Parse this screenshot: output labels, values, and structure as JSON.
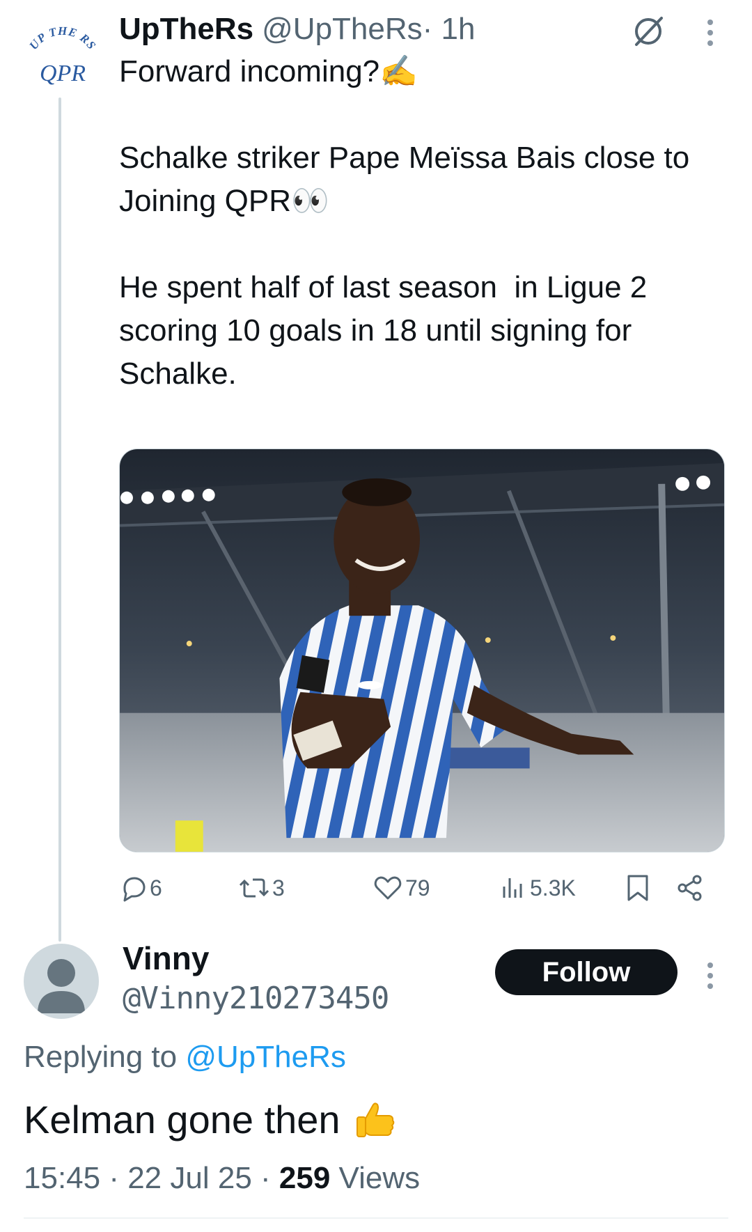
{
  "tweet": {
    "author_name": "UpTheRs",
    "author_handle": "@UpTheRs",
    "time": " · 1h",
    "logo_text_top": "UP THE RS",
    "logo_text_bottom": "QPR",
    "text": "Forward incoming?✍️\n\nSchalke striker Pape Meïssa Bais close to\nJoining QPR👀\n\nHe spent half of last season  in Ligue 2 scoring 10 goals in 18 until signing for Schalke.",
    "media_alt": "Player in blue and white striped kit celebrating in a stadium",
    "actions": {
      "replies": "6",
      "reposts": "3",
      "likes": "79",
      "views": "5.3K"
    }
  },
  "reply": {
    "author_name": "Vinny",
    "author_handle": "@Vinny210273450",
    "follow_label": "Follow",
    "replying_prefix": "Replying to ",
    "replying_to": "@UpTheRs",
    "text": "Kelman gone then",
    "time": "15:45 · 22 Jul 25 · ",
    "views_count": "259",
    "views_label": " Views"
  },
  "colors": {
    "text_primary": "#0f1419",
    "text_secondary": "#536471",
    "accent": "#1d9bf0",
    "button_bg": "#0f1419",
    "divider": "#cfd9de"
  },
  "icons": [
    "logo",
    "grok-icon",
    "more-icon",
    "reply-icon",
    "repost-icon",
    "like-icon",
    "views-icon",
    "bookmark-icon",
    "share-icon",
    "avatar-placeholder",
    "thumbs-up-icon"
  ]
}
